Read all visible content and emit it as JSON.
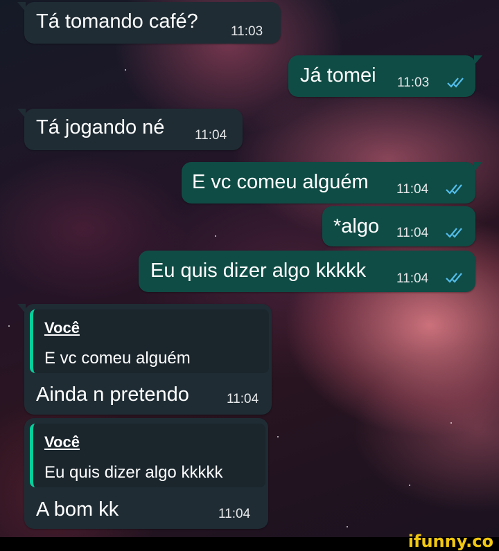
{
  "messages": [
    {
      "text": "Tá tomando café?",
      "time": "11:03"
    },
    {
      "text": "Já tomei",
      "time": "11:03"
    },
    {
      "text": "Tá jogando né",
      "time": "11:04"
    },
    {
      "text": "E vc comeu alguém",
      "time": "11:04"
    },
    {
      "text": "*algo",
      "time": "11:04"
    },
    {
      "text": "Eu quis dizer algo kkkkk",
      "time": "11:04"
    },
    {
      "text": "Ainda n pretendo",
      "time": "11:04",
      "quote": {
        "author": "Você",
        "text": "E vc comeu alguém"
      }
    },
    {
      "text": "A bom kk",
      "time": "11:04",
      "quote": {
        "author": "Você",
        "text": "Eu quis dizer algo kkkkk"
      }
    }
  ],
  "colors": {
    "incoming_bubble": "#1f2c34",
    "outgoing_bubble": "#0f4c45",
    "read_ticks": "#53bdeb",
    "quote_bar": "#06cf9c",
    "brand": "#f2c811"
  },
  "icons": {
    "read_receipt": "double-check-icon"
  },
  "watermark": "ifunny.co"
}
